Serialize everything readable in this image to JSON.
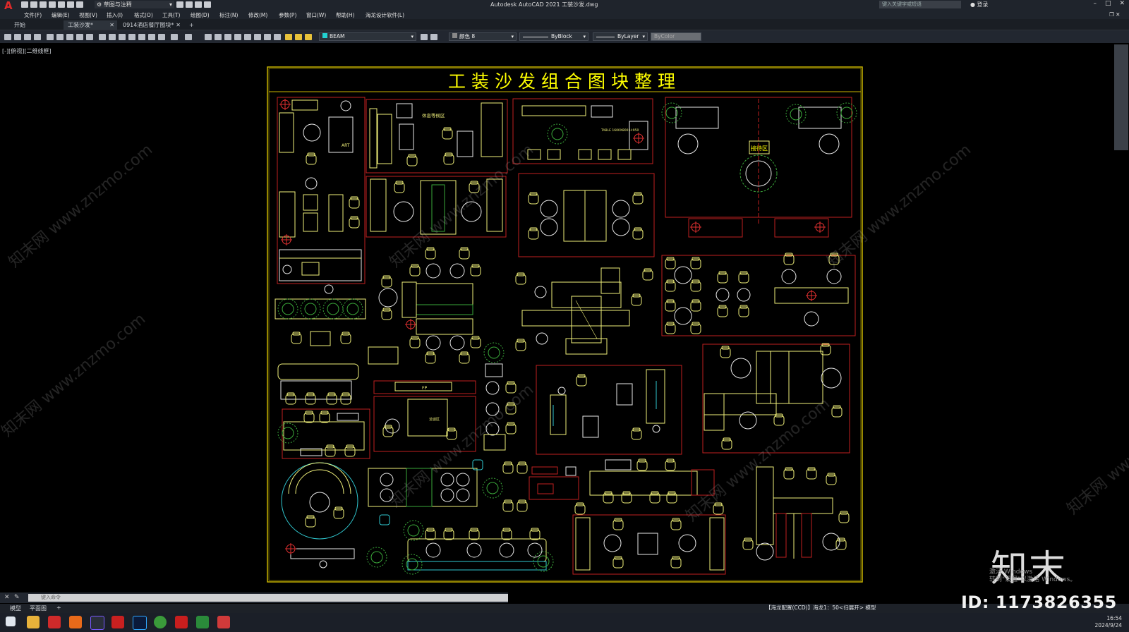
{
  "titlebar": {
    "logo": "A",
    "workspace": "草图与注释",
    "app_title": "Autodesk AutoCAD 2021    工装沙发.dwg",
    "search_placeholder": "键入关键字或短语",
    "login": "登录",
    "min": "–",
    "max": "□",
    "close": "✕"
  },
  "menu": [
    "文件(F)",
    "编辑(E)",
    "视图(V)",
    "插入(I)",
    "格式(O)",
    "工具(T)",
    "绘图(D)",
    "标注(N)",
    "修改(M)",
    "参数(P)",
    "窗口(W)",
    "帮助(H)",
    "海龙设计软件(L)"
  ],
  "tabs": [
    {
      "label": "开始"
    },
    {
      "label": "工装沙发*"
    },
    {
      "label": "0914酒店餐厅图块*"
    }
  ],
  "tab_add": "+",
  "toolbar": {
    "layer": "BEAM",
    "color": "颜色 8",
    "linetype": "ByBlock",
    "lineweight": "ByLayer",
    "plotstyle": "ByColor"
  },
  "viewport_label": "[-][俯视][二维线框]",
  "drawing": {
    "title": "工装沙发组合图块整理",
    "label_lounge": "休息等候区",
    "label_reception": "接待区",
    "label_table": "TABLE 1600X800 H:950",
    "label_art": "ART",
    "label_fp": "FP",
    "label_area": "洽谈区"
  },
  "command": {
    "placeholder": "键入命令"
  },
  "layout_tabs": [
    "模型",
    "平面图"
  ],
  "status": {
    "text": "【海龙配置(CCD)】海龙1：50<归展开>   模型"
  },
  "watermark": {
    "site": "知末网 www.znzmo.com",
    "brand": "知末",
    "id": "ID: 1173826355",
    "activate_line1": "激活 Windows",
    "activate_line2": "转到\"设置\"以激活 Windows。"
  },
  "clock": {
    "time": "16:54",
    "date": "2024/9/24"
  },
  "colors": {
    "frame": "#c8b400",
    "title": "#ffff00",
    "line_yellow": "#f0f07a",
    "line_white": "#e8e8e8",
    "red": "#c02020",
    "green": "#3aa83a",
    "cyan": "#30c8d0",
    "brand_red": "#e02a2a"
  }
}
